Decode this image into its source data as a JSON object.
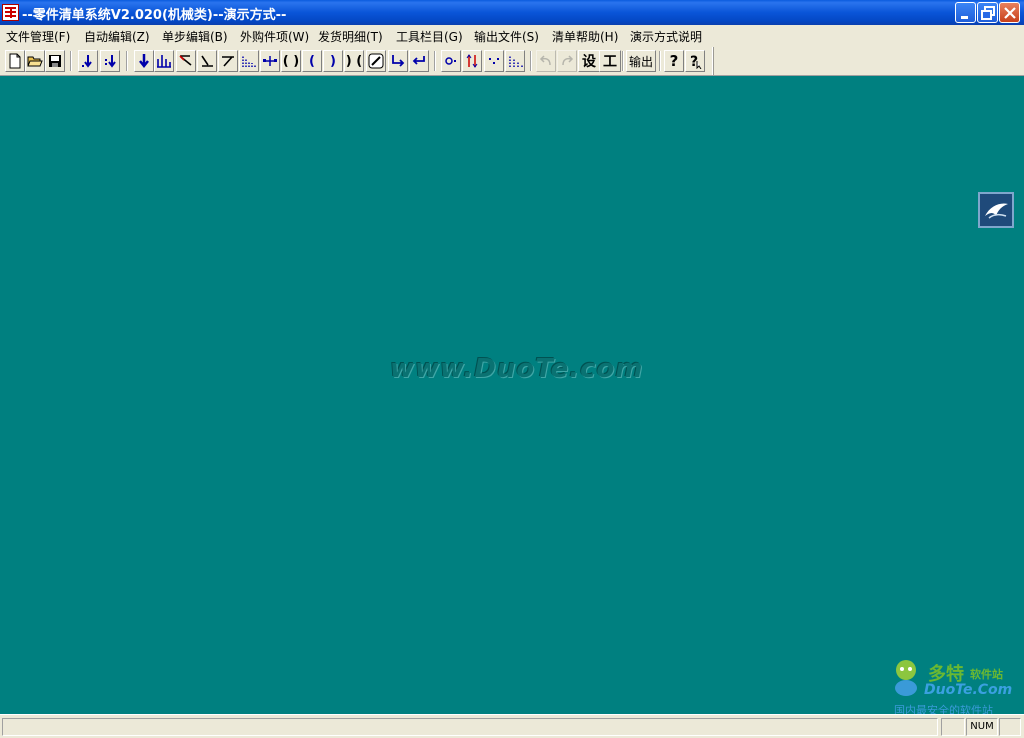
{
  "window": {
    "title": "--零件清单系统V2.020(机械类)--演示方式--"
  },
  "menu": [
    {
      "label": "文件管理(F)"
    },
    {
      "label": "自动编辑(Z)"
    },
    {
      "label": "单步编辑(B)"
    },
    {
      "label": "外购件项(W)"
    },
    {
      "label": "发货明细(T)"
    },
    {
      "label": "工具栏目(G)"
    },
    {
      "label": "输出文件(S)"
    },
    {
      "label": "清单帮助(H)"
    },
    {
      "label": "演示方式说明"
    }
  ],
  "toolbar": {
    "output_label": "输出",
    "design_label": "设",
    "craft_label": "工"
  },
  "workspace": {
    "watermark": "www.DuoTe.com",
    "bg_color": "#008080"
  },
  "logo": {
    "cn": "多特",
    "sub": "软件站",
    "en": "DuoTe.Com",
    "tagline": "国内最安全的软件站"
  },
  "status": {
    "num": "NUM"
  }
}
